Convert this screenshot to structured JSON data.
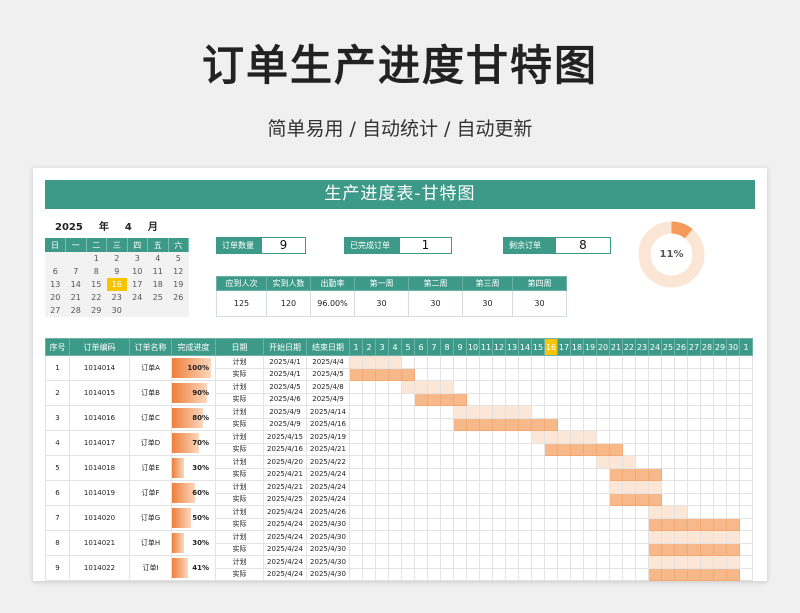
{
  "page": {
    "title": "订单生产进度甘特图",
    "subtitle": "简单易用 / 自动统计 / 自动更新"
  },
  "sheet": {
    "banner": "生产进度表-甘特图",
    "year": "2025",
    "year_label": "年",
    "month": "4",
    "month_label": "月"
  },
  "calendar": {
    "weekdays": [
      "日",
      "一",
      "二",
      "三",
      "四",
      "五",
      "六"
    ],
    "weeks": [
      [
        "",
        "",
        "1",
        "2",
        "3",
        "4",
        "5"
      ],
      [
        "6",
        "7",
        "8",
        "9",
        "10",
        "11",
        "12"
      ],
      [
        "13",
        "14",
        "15",
        "16",
        "17",
        "18",
        "19"
      ],
      [
        "20",
        "21",
        "22",
        "23",
        "24",
        "25",
        "26"
      ],
      [
        "27",
        "28",
        "29",
        "30",
        "",
        "",
        ""
      ]
    ],
    "today": "16"
  },
  "stats": [
    {
      "label": "订单数量",
      "value": "9"
    },
    {
      "label": "已完成订单",
      "value": "1"
    },
    {
      "label": "剩余订单",
      "value": "8"
    }
  ],
  "donut": {
    "percent": 11,
    "label": "11%",
    "track_color": "#fbe5d4",
    "fill_color": "#f59a5a"
  },
  "summary": {
    "headers": [
      "应到人次",
      "实到人数",
      "出勤率",
      "第一周",
      "第二周",
      "第三周",
      "第四周"
    ],
    "values": [
      "125",
      "120",
      "96.00%",
      "30",
      "30",
      "30",
      "30"
    ]
  },
  "gantt": {
    "headers": [
      "序号",
      "订单编码",
      "订单名称",
      "完成进度",
      "日期",
      "开始日期",
      "结束日期"
    ],
    "days": [
      "1",
      "2",
      "3",
      "4",
      "5",
      "6",
      "7",
      "8",
      "9",
      "10",
      "11",
      "12",
      "13",
      "14",
      "15",
      "16",
      "17",
      "18",
      "19",
      "20",
      "21",
      "22",
      "23",
      "24",
      "25",
      "26",
      "27",
      "28",
      "29",
      "30",
      "1"
    ],
    "today_index": 15,
    "plan_label": "计划",
    "actual_label": "实际",
    "orders": [
      {
        "no": "1",
        "code": "1014014",
        "name": "订单A",
        "progress": 100,
        "progress_label": "100%",
        "plan": [
          "2025/4/1",
          "2025/4/4"
        ],
        "actual": [
          "2025/4/1",
          "2025/4/5"
        ]
      },
      {
        "no": "2",
        "code": "1014015",
        "name": "订单B",
        "progress": 90,
        "progress_label": "90%",
        "plan": [
          "2025/4/5",
          "2025/4/8"
        ],
        "actual": [
          "2025/4/6",
          "2025/4/9"
        ]
      },
      {
        "no": "3",
        "code": "1014016",
        "name": "订单C",
        "progress": 80,
        "progress_label": "80%",
        "plan": [
          "2025/4/9",
          "2025/4/14"
        ],
        "actual": [
          "2025/4/9",
          "2025/4/16"
        ]
      },
      {
        "no": "4",
        "code": "1014017",
        "name": "订单D",
        "progress": 70,
        "progress_label": "70%",
        "plan": [
          "2025/4/15",
          "2025/4/19"
        ],
        "actual": [
          "2025/4/16",
          "2025/4/21"
        ]
      },
      {
        "no": "5",
        "code": "1014018",
        "name": "订单E",
        "progress": 30,
        "progress_label": "30%",
        "plan": [
          "2025/4/20",
          "2025/4/22"
        ],
        "actual": [
          "2025/4/21",
          "2025/4/24"
        ]
      },
      {
        "no": "6",
        "code": "1014019",
        "name": "订单F",
        "progress": 60,
        "progress_label": "60%",
        "plan": [
          "2025/4/21",
          "2025/4/24"
        ],
        "actual": [
          "2025/4/25",
          "2025/4/24"
        ]
      },
      {
        "no": "7",
        "code": "1014020",
        "name": "订单G",
        "progress": 50,
        "progress_label": "50%",
        "plan": [
          "2025/4/24",
          "2025/4/26"
        ],
        "actual": [
          "2025/4/24",
          "2025/4/30"
        ]
      },
      {
        "no": "8",
        "code": "1014021",
        "name": "订单H",
        "progress": 30,
        "progress_label": "30%",
        "plan": [
          "2025/4/24",
          "2025/4/30"
        ],
        "actual": [
          "2025/4/24",
          "2025/4/30"
        ]
      },
      {
        "no": "9",
        "code": "1014022",
        "name": "订单I",
        "progress": 41,
        "progress_label": "41%",
        "plan": [
          "2025/4/24",
          "2025/4/30"
        ],
        "actual": [
          "2025/4/24",
          "2025/4/30"
        ]
      }
    ],
    "bars": [
      {
        "plan": [
          1,
          4
        ],
        "actual": [
          1,
          5
        ]
      },
      {
        "plan": [
          5,
          8
        ],
        "actual": [
          6,
          9
        ]
      },
      {
        "plan": [
          9,
          14
        ],
        "actual": [
          9,
          16
        ]
      },
      {
        "plan": [
          15,
          19
        ],
        "actual": [
          16,
          21
        ]
      },
      {
        "plan": [
          20,
          22
        ],
        "actual": [
          21,
          24
        ]
      },
      {
        "plan": [
          21,
          24
        ],
        "actual": [
          21,
          24
        ]
      },
      {
        "plan": [
          24,
          26
        ],
        "actual": [
          24,
          30
        ]
      },
      {
        "plan": [
          24,
          30
        ],
        "actual": [
          24,
          30
        ]
      },
      {
        "plan": [
          24,
          30
        ],
        "actual": [
          24,
          30
        ]
      }
    ]
  }
}
